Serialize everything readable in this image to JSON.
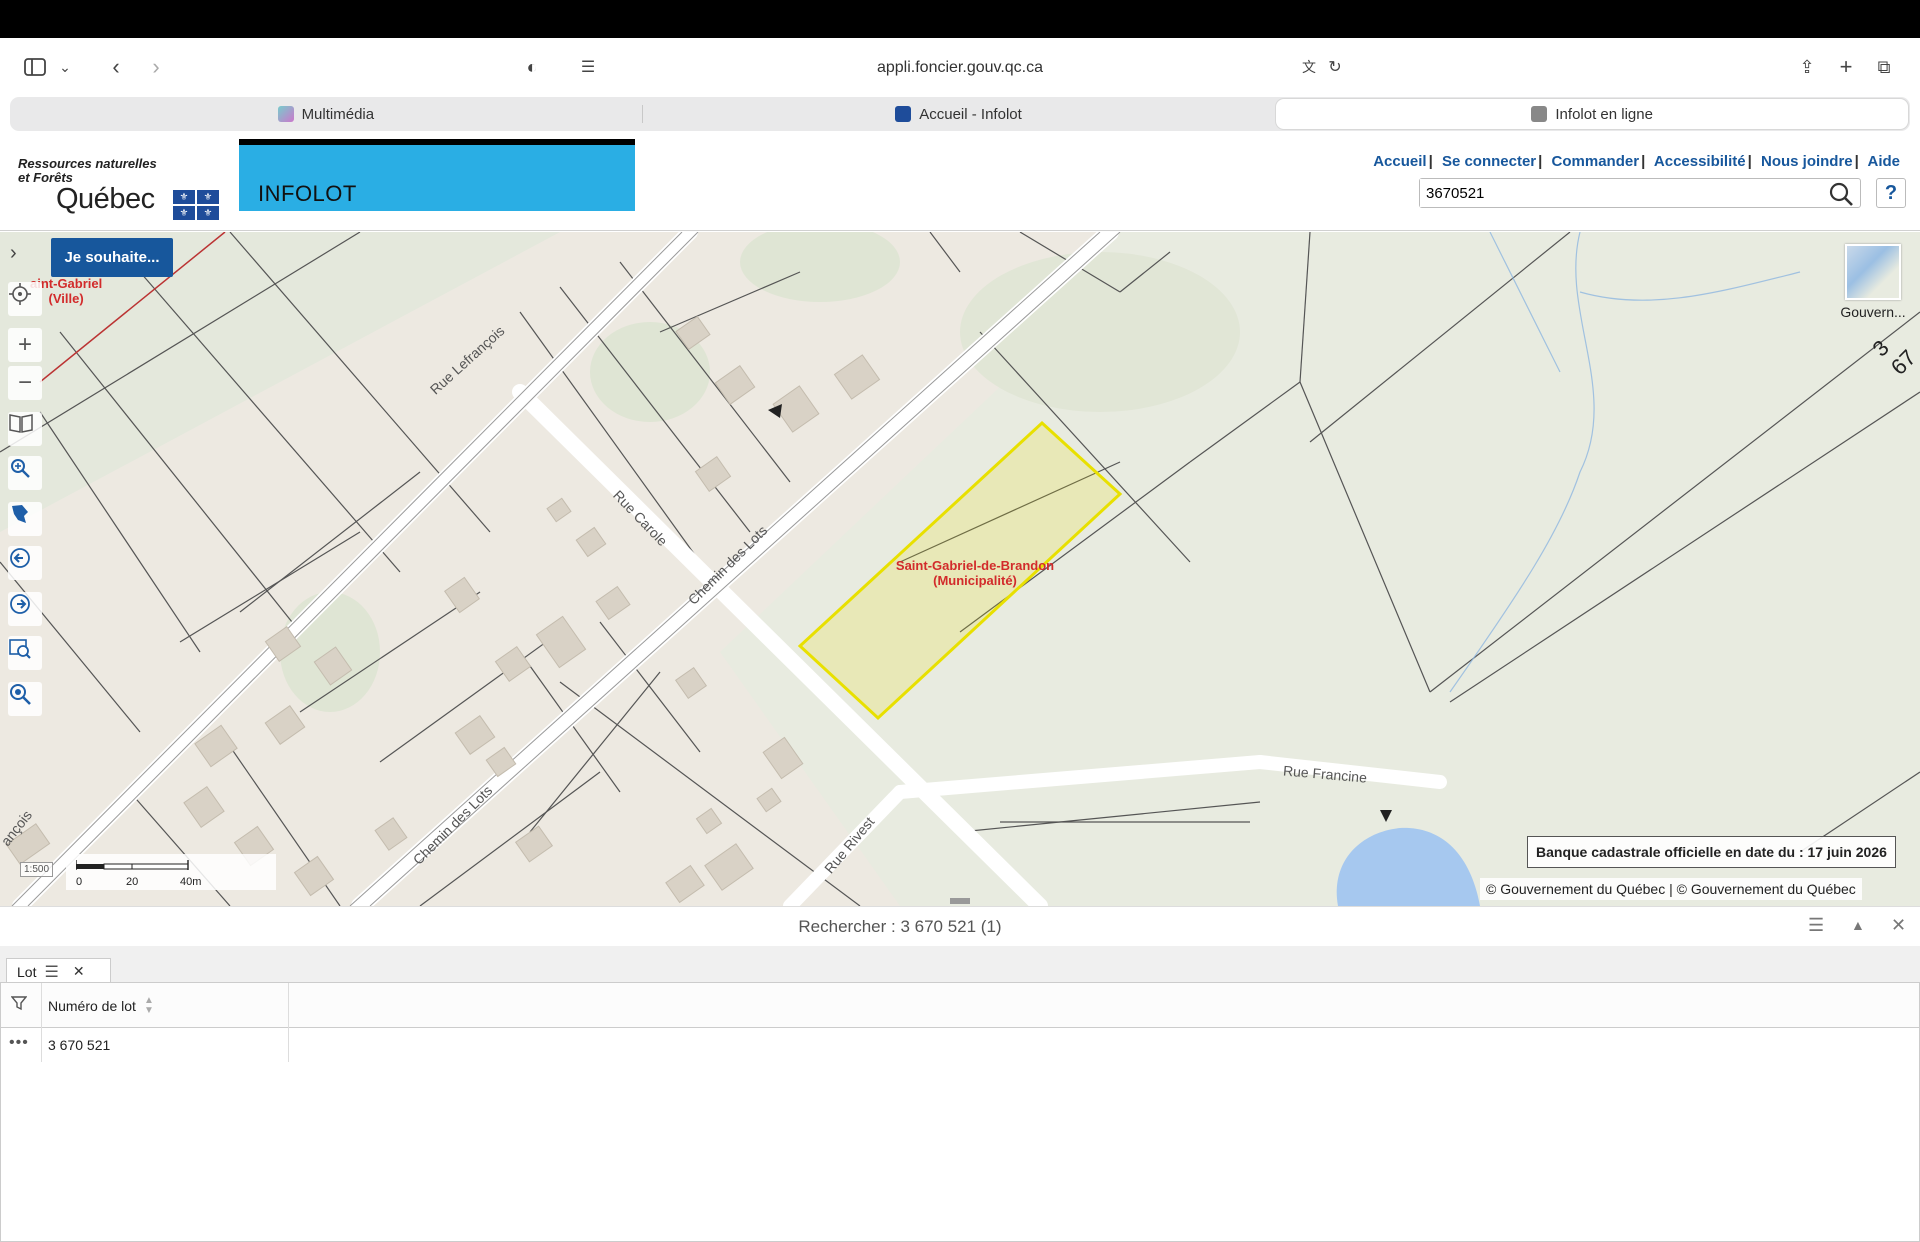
{
  "browser": {
    "url": "appli.foncier.gouv.qc.ca",
    "tabs": [
      {
        "label": "Multimédia",
        "active": false
      },
      {
        "label": "Accueil - Infolot",
        "active": false
      },
      {
        "label": "Infolot en ligne",
        "active": true
      }
    ]
  },
  "header": {
    "ministry_line1": "Ressources naturelles",
    "ministry_line2": "et Forêts",
    "logo_word": "Québec",
    "banner": "INFOLOT",
    "links": [
      "Accueil",
      "Se connecter",
      "Commander",
      "Accessibilité",
      "Nous joindre",
      "Aide"
    ],
    "search_value": "3670521",
    "help": "?"
  },
  "map": {
    "action_button": "Je souhaite...",
    "basemap_label": "Gouvern...",
    "municipality_top_left": "aint-Gabriel",
    "municipality_top_left_type": "(Ville)",
    "municipality_center": "Saint-Gabriel-de-Brandon",
    "municipality_center_type": "(Municipalité)",
    "lot_fragment": "3 67",
    "streets": [
      "Rue Lefrançois",
      "Rue Carole",
      "Chemin des Lots",
      "Chemin des Lots",
      "Rue Francine",
      "Rue Rivest",
      "ançois"
    ],
    "cadastre_date": "Banque cadastrale officielle en date du : 17 juin 2026",
    "copyright": "© Gouvernement du Québec | © Gouvernement du Québec",
    "scale_labels": [
      "0",
      "20",
      "40m"
    ],
    "ratio": "1:500"
  },
  "results": {
    "title": "Rechercher : 3 670 521 (1)",
    "tab_label": "Lot",
    "column": "Numéro de lot",
    "rows": [
      "3 670 521"
    ]
  },
  "colors": {
    "brand_blue": "#17579c",
    "banner_cyan": "#2aaee4",
    "selection_yellow": "#e8e000",
    "municipality_red": "#d22b2b"
  }
}
